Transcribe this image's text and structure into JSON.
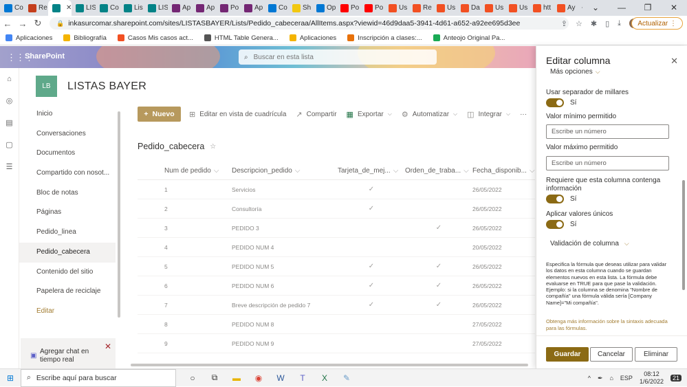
{
  "browser": {
    "tabs": [
      {
        "label": "Co",
        "color": "#0078d4"
      },
      {
        "label": "Re",
        "color": "#c43e1c"
      },
      {
        "label": "",
        "color": "#038387",
        "active": true
      },
      {
        "label": "LIS",
        "color": "#038387"
      },
      {
        "label": "Co",
        "color": "#038387"
      },
      {
        "label": "Lis",
        "color": "#038387"
      },
      {
        "label": "LIS",
        "color": "#038387"
      },
      {
        "label": "Ap",
        "color": "#742774"
      },
      {
        "label": "Ap",
        "color": "#742774"
      },
      {
        "label": "Po",
        "color": "#742774"
      },
      {
        "label": "Ap",
        "color": "#742774"
      },
      {
        "label": "Co",
        "color": "#0078d4"
      },
      {
        "label": "Sh",
        "color": "#f2c811"
      },
      {
        "label": "Op",
        "color": "#0078d4"
      },
      {
        "label": "Po",
        "color": "#ff0000"
      },
      {
        "label": "Po",
        "color": "#ff0000"
      },
      {
        "label": "Us",
        "color": "#f25022"
      },
      {
        "label": "Re",
        "color": "#f25022"
      },
      {
        "label": "Us",
        "color": "#f25022"
      },
      {
        "label": "Da",
        "color": "#f25022"
      },
      {
        "label": "Us",
        "color": "#f25022"
      },
      {
        "label": "Us",
        "color": "#f25022"
      },
      {
        "label": "htt",
        "color": "#f25022"
      },
      {
        "label": "Ay",
        "color": "#f25022"
      }
    ],
    "new_tab": "+",
    "window_controls": [
      "⌄",
      "—",
      "❐",
      "✕"
    ],
    "url": "inkasurcomar.sharepoint.com/sites/LISTASBAYER/Lists/Pedido_cabeceraa/AllItems.aspx?viewid=46d9daa5-3941-4d61-a652-a92ee695d3ee",
    "update_label": "Actualizar",
    "bookmarks": [
      {
        "label": "Aplicaciones",
        "color": "#4285f4"
      },
      {
        "label": "Bibliografía",
        "color": "#f4b400"
      },
      {
        "label": "Casos Mis casos act...",
        "color": "#f25022"
      },
      {
        "label": "HTML Table Genera...",
        "color": "#555555"
      },
      {
        "label": "Aplicaciones",
        "color": "#f4b400"
      },
      {
        "label": "Inscripción a clases:...",
        "color": "#e8710a"
      },
      {
        "label": "Anteojo Original Pa...",
        "color": "#1aaa55"
      }
    ]
  },
  "suite": {
    "brand": "SharePoint",
    "search_placeholder": "Buscar en esta lista"
  },
  "site": {
    "logo": "LB",
    "title": "LISTAS BAYER"
  },
  "nav": {
    "items": [
      "Inicio",
      "Conversaciones",
      "Documentos",
      "Compartido con nosot...",
      "Bloc de notas",
      "Páginas",
      "Pedido_linea",
      "Pedido_cabecera",
      "Contenido del sitio",
      "Papelera de reciclaje",
      "Editar"
    ],
    "selected": "Pedido_cabecera",
    "chat_line1": "Agregar chat en",
    "chat_line2": "tiempo real"
  },
  "command_bar": {
    "new": "Nuevo",
    "grid_edit": "Editar en vista de cuadrícula",
    "share": "Compartir",
    "export": "Exportar",
    "automate": "Automatizar",
    "integrate": "Integrar",
    "more": "···"
  },
  "list": {
    "title": "Pedido_cabecera",
    "columns": [
      "Num de pedido",
      "Descripcion_pedido",
      "Tarjeta_de_mej...",
      "Orden_de_traba...",
      "Fecha_disponib..."
    ],
    "rows": [
      {
        "num": "1",
        "desc": "Servicios",
        "tarjeta": true,
        "orden": false,
        "fecha": "26/05/2022"
      },
      {
        "num": "2",
        "desc": "Consultoría",
        "tarjeta": true,
        "orden": false,
        "fecha": "26/05/2022"
      },
      {
        "num": "3",
        "desc": "PEDIDO 3",
        "tarjeta": false,
        "orden": true,
        "fecha": "26/05/2022"
      },
      {
        "num": "4",
        "desc": "PEDIDO NUM 4",
        "tarjeta": false,
        "orden": false,
        "fecha": "20/05/2022"
      },
      {
        "num": "5",
        "desc": "PEDIDO NUM 5",
        "tarjeta": true,
        "orden": true,
        "fecha": "26/05/2022"
      },
      {
        "num": "6",
        "desc": "PEDIDO NUM 6",
        "tarjeta": true,
        "orden": true,
        "fecha": "26/05/2022"
      },
      {
        "num": "7",
        "desc": "Breve descripción de pedido 7",
        "tarjeta": true,
        "orden": true,
        "fecha": "26/05/2022"
      },
      {
        "num": "8",
        "desc": "PEDIDO NUM 8",
        "tarjeta": false,
        "orden": false,
        "fecha": "27/05/2022"
      },
      {
        "num": "9",
        "desc": "PEDIDO NUM 9",
        "tarjeta": false,
        "orden": false,
        "fecha": "27/05/2022"
      }
    ]
  },
  "panel": {
    "title": "Editar columna",
    "more_options": "Más opciones",
    "thousands_label": "Usar separador de millares",
    "thousands_value": "Sí",
    "min_label": "Valor mínimo permitido",
    "min_placeholder": "Escribe un número",
    "max_label": "Valor máximo permitido",
    "max_placeholder": "Escribe un número",
    "required_label": "Requiere que esta columna contenga información",
    "required_value": "Sí",
    "unique_label": "Aplicar valores únicos",
    "unique_value": "Sí",
    "validation_label": "Validación de columna",
    "validation_desc": "Especifica la fórmula que deseas utilizar para validar los datos en esta columna cuando se guardan elementos nuevos en esta lista. La fórmula debe evaluarse en TRUE para que pase la validación. Ejemplo: si la columna se denomina \"Nombre de compañía\" una fórmula válida sería [Company Name]=\"Mi compañía\".",
    "learn_more": "Obtenga más información sobre la sintaxis adecuada para las fórmulas.",
    "save": "Guardar",
    "cancel": "Cancelar",
    "delete": "Eliminar"
  },
  "taskbar": {
    "search": "Escribe aquí para buscar",
    "lang": "ESP",
    "time": "08:12",
    "date": "1/6/2022",
    "notif": "21"
  }
}
